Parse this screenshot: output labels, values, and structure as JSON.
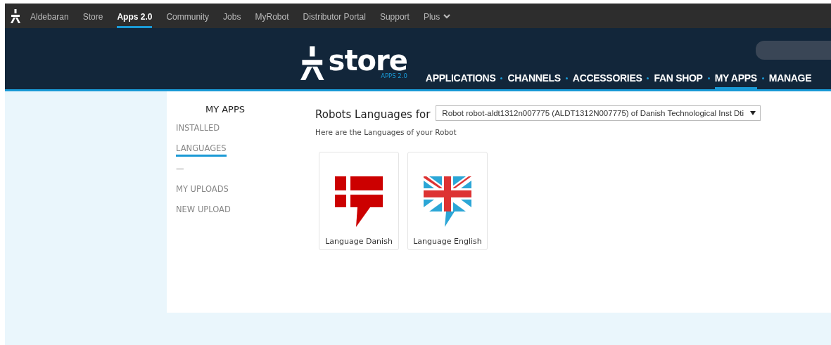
{
  "top_nav": [
    {
      "label": "Aldebaran",
      "selected": false
    },
    {
      "label": "Store",
      "selected": false
    },
    {
      "label": "Apps 2.0",
      "selected": true
    },
    {
      "label": "Community",
      "selected": false
    },
    {
      "label": "Jobs",
      "selected": false
    },
    {
      "label": "MyRobot",
      "selected": false
    },
    {
      "label": "Distributor Portal",
      "selected": false
    },
    {
      "label": "Support",
      "selected": false
    },
    {
      "label": "Plus",
      "selected": false,
      "dropdown": true
    }
  ],
  "header": {
    "logo": "store",
    "logo_sub": "APPS 2.0",
    "nav": [
      {
        "label": "APPLICATIONS",
        "selected": false
      },
      {
        "label": "CHANNELS",
        "selected": false
      },
      {
        "label": "ACCESSORIES",
        "selected": false
      },
      {
        "label": "FAN SHOP",
        "selected": false
      },
      {
        "label": "MY APPS",
        "selected": true
      },
      {
        "label": "MANAGE",
        "selected": false
      }
    ]
  },
  "sidebar": {
    "title": "MY APPS",
    "items": [
      {
        "label": "INSTALLED",
        "selected": false
      },
      {
        "label": "LANGUAGES",
        "selected": true
      },
      {
        "label": "—",
        "selected": false
      },
      {
        "label": "MY UPLOADS",
        "selected": false
      },
      {
        "label": "NEW UPLOAD",
        "selected": false
      }
    ]
  },
  "content": {
    "heading": "Robots Languages for",
    "robot_select": "Robot robot-aldt1312n007775 (ALDT1312N007775) of Danish Technological Inst Dti",
    "subtitle": "Here are the Languages of your Robot",
    "languages": [
      {
        "label": "Language Danish",
        "kind": "danish"
      },
      {
        "label": "Language English",
        "kind": "english"
      }
    ]
  }
}
